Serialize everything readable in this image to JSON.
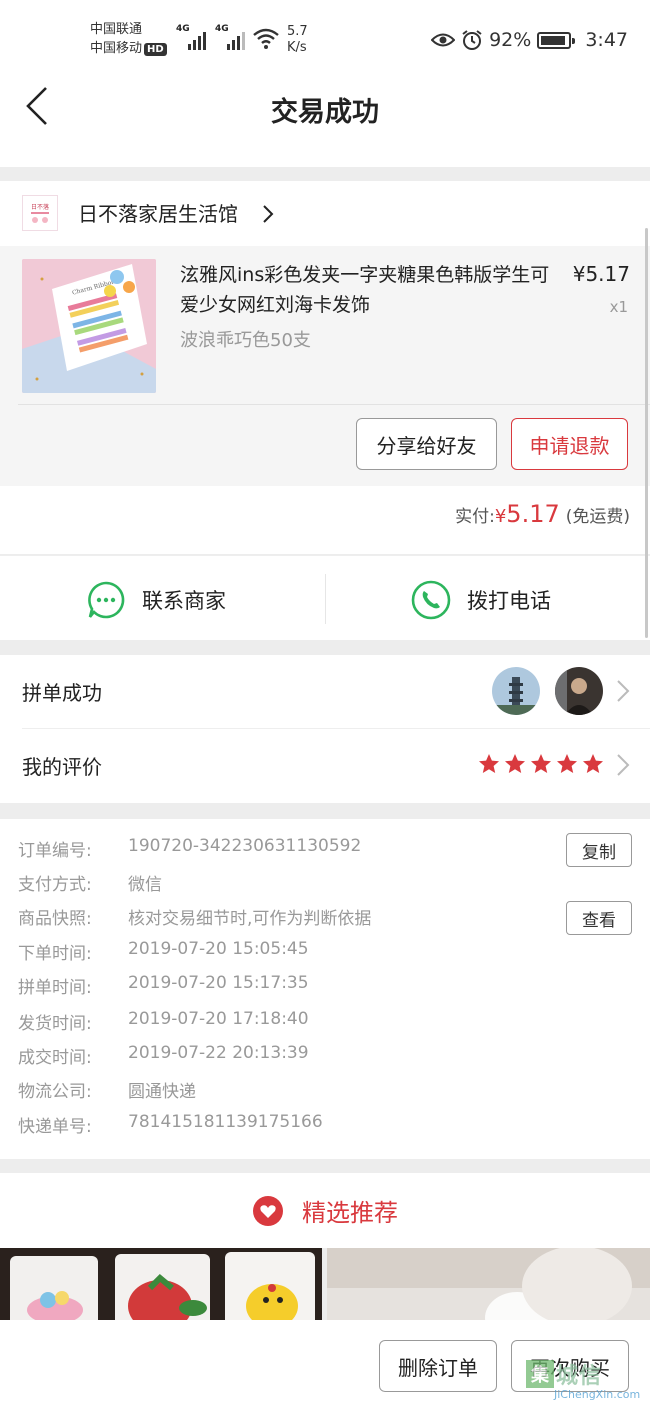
{
  "status_bar": {
    "carrier1": "中国联通",
    "carrier2": "中国移动",
    "hd": "HD",
    "net1": "4G",
    "net2": "4G",
    "speed_value": "5.7",
    "speed_unit": "K/s",
    "battery": "92%",
    "battery_level": 0.92,
    "time": "3:47"
  },
  "header": {
    "title": "交易成功"
  },
  "store": {
    "name": "日不落家居生活馆",
    "logo_text": "日不落"
  },
  "product": {
    "name": "泫雅风ins彩色发夹一字夹糖果色韩版学生可爱少女网红刘海卡发饰",
    "variant": "波浪乖巧色50支",
    "price": "¥5.17",
    "qty": "x1",
    "card_text": "Charm Ribbon"
  },
  "actions": {
    "share": "分享给好友",
    "refund": "申请退款"
  },
  "payment": {
    "label": "实付:",
    "currency": "¥",
    "amount": "5.17",
    "note": "(免运费)"
  },
  "contact": {
    "merchant": "联系商家",
    "phone": "拨打电话"
  },
  "group": {
    "label": "拼单成功"
  },
  "review": {
    "label": "我的评价",
    "stars": 5
  },
  "order": {
    "copy_label": "复制",
    "view_label": "查看",
    "rows": [
      {
        "key": "订单编号:",
        "value": "190720-342230631130592"
      },
      {
        "key": "支付方式:",
        "value": "微信"
      },
      {
        "key": "商品快照:",
        "value": "核对交易细节时,可作为判断依据"
      },
      {
        "key": "下单时间:",
        "value": "2019-07-20 15:05:45"
      },
      {
        "key": "拼单时间:",
        "value": "2019-07-20 15:17:35"
      },
      {
        "key": "发货时间:",
        "value": "2019-07-20 17:18:40"
      },
      {
        "key": "成交时间:",
        "value": "2019-07-22 20:13:39"
      },
      {
        "key": "物流公司:",
        "value": "圆通快递"
      },
      {
        "key": "快递单号:",
        "value": "781415181139175166"
      }
    ]
  },
  "recommend": {
    "title": "精选推荐"
  },
  "bottom": {
    "delete": "删除订单",
    "rebuy": "再次购买"
  },
  "watermark": {
    "text": "城信",
    "sub": "JiChengXin.com",
    "logo": "集"
  },
  "colors": {
    "accent": "#d9393e",
    "green": "#2db55d",
    "star": "#d9393e"
  }
}
